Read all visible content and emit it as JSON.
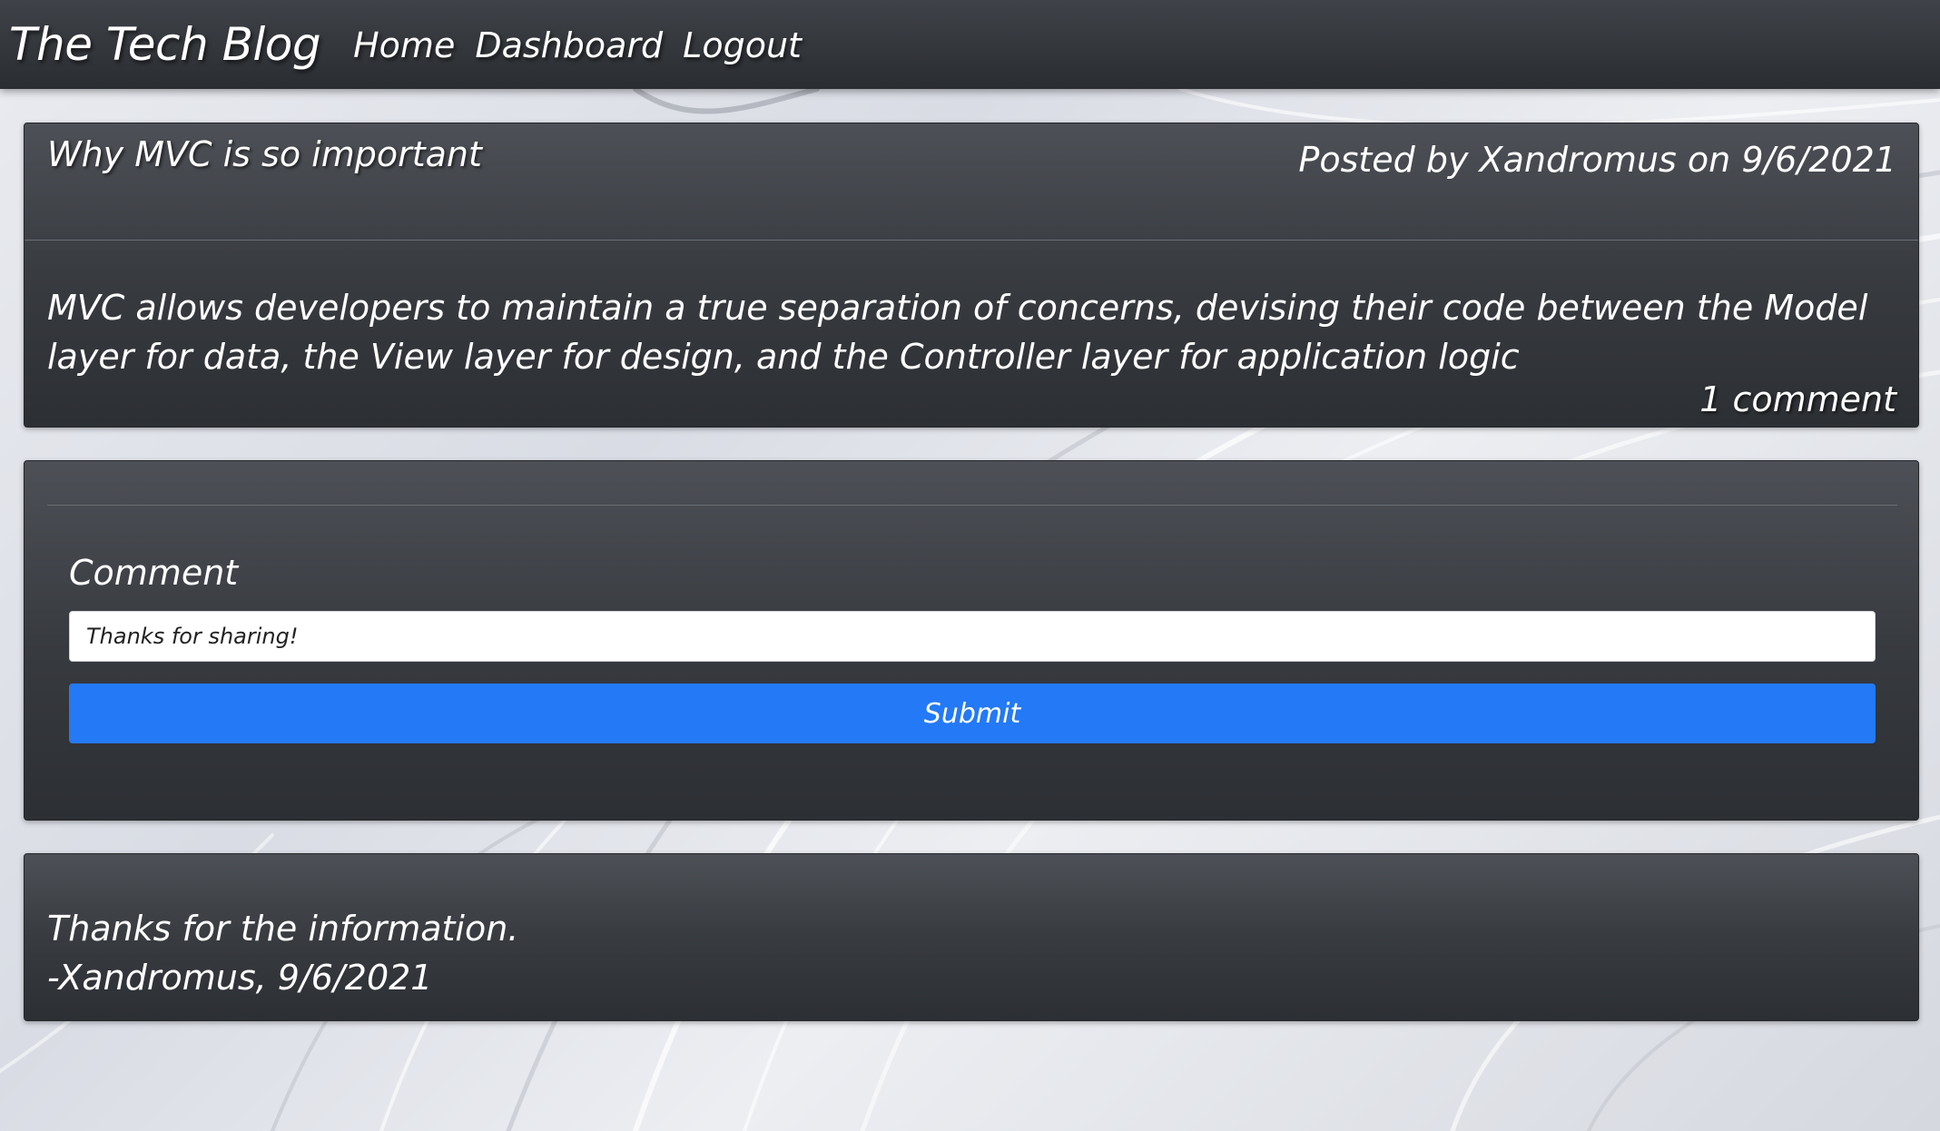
{
  "navbar": {
    "brand": "The Tech Blog",
    "links": [
      {
        "label": "Home"
      },
      {
        "label": "Dashboard"
      },
      {
        "label": "Logout"
      }
    ]
  },
  "post": {
    "title": "Why MVC is so important",
    "meta": "Posted by Xandromus on 9/6/2021",
    "body": "MVC allows developers to maintain a true separation of concerns, devising their code between the Model layer for data, the View layer for design, and the Controller layer for application logic",
    "comment_count": "1 comment"
  },
  "comment_form": {
    "label": "Comment",
    "input_value": "Thanks for sharing!",
    "submit_label": "Submit"
  },
  "comments": [
    {
      "text": "Thanks for the information.",
      "byline": "-Xandromus, 9/6/2021"
    }
  ],
  "colors": {
    "navbar": "#2e3135",
    "card": "#3a3d42",
    "submit_button": "#2379f6",
    "background": "#e3e5ea"
  }
}
